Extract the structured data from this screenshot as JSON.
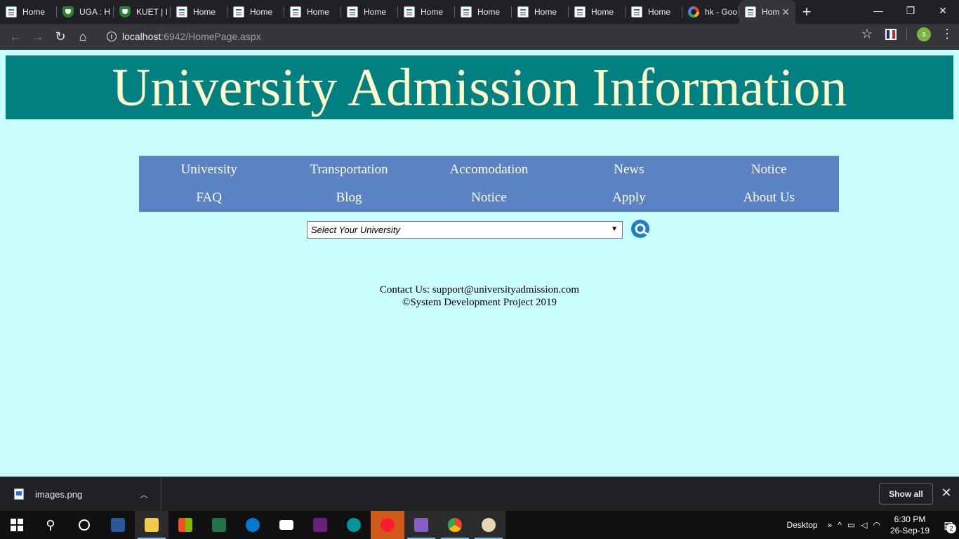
{
  "browser": {
    "tabs": [
      {
        "title": "Home",
        "icon": "page-icon"
      },
      {
        "title": "UGA : H",
        "icon": "shield-icon"
      },
      {
        "title": "KUET | I",
        "icon": "shield-icon"
      },
      {
        "title": "Home",
        "icon": "page-icon"
      },
      {
        "title": "Home",
        "icon": "page-icon"
      },
      {
        "title": "Home",
        "icon": "page-icon"
      },
      {
        "title": "Home",
        "icon": "page-icon"
      },
      {
        "title": "Home",
        "icon": "page-icon"
      },
      {
        "title": "Home",
        "icon": "page-icon"
      },
      {
        "title": "Home",
        "icon": "page-icon"
      },
      {
        "title": "Home",
        "icon": "page-icon"
      },
      {
        "title": "Home",
        "icon": "page-icon"
      },
      {
        "title": "hk - Goo",
        "icon": "google-icon"
      },
      {
        "title": "Hom",
        "icon": "page-icon",
        "active": true
      }
    ],
    "new_tab": "+",
    "window_controls": {
      "minimize": "—",
      "restore": "❐",
      "close": "✕"
    },
    "url_host": "localhost",
    "url_path": ":6942/HomePage.aspx",
    "profile_initial": "s"
  },
  "page": {
    "banner_title": "University Admission Information",
    "menu_row1": [
      "University",
      "Transportation",
      "Accomodation",
      "News",
      "Notice"
    ],
    "menu_row2": [
      "FAQ",
      "Blog",
      "Notice",
      "Apply",
      "About Us"
    ],
    "select_placeholder": "Select Your University",
    "footer_contact": "Contact Us: support@universityadmission.com",
    "footer_copyright": "©System Development Project 2019"
  },
  "download_bar": {
    "file_name": "images.png",
    "show_all": "Show all"
  },
  "taskbar": {
    "desktop_label": "Desktop",
    "time": "6:30 PM",
    "date": "26-Sep-19",
    "notification_count": "2"
  },
  "colors": {
    "page_bg": "#c8fffe",
    "banner_bg": "#008080",
    "banner_text": "#ffffcc",
    "menu_bg": "#5b82c2"
  }
}
